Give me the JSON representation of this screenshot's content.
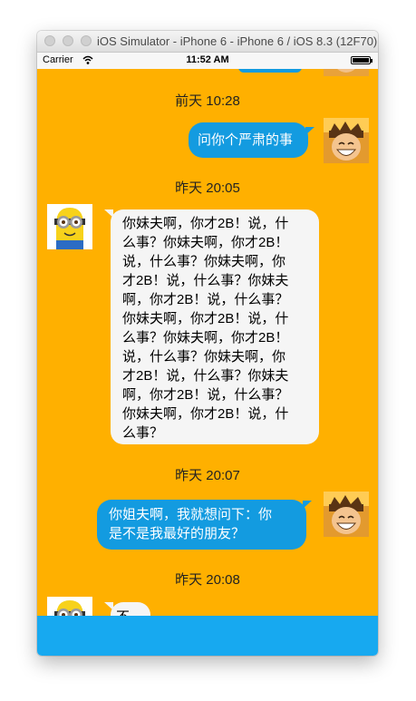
{
  "window": {
    "title": "iOS Simulator - iPhone 6 - iPhone 6 / iOS 8.3 (12F70)"
  },
  "status_bar": {
    "carrier": "Carrier",
    "time": "11:52 AM",
    "battery_level": 1.0
  },
  "colors": {
    "chat_background": "#ffb000",
    "outgoing_bubble": "#139be0",
    "incoming_bubble": "#f5f5f5",
    "input_bar": "#17a9f0"
  },
  "messages": [
    {
      "timestamp": "前天 10:28",
      "direction": "outgoing",
      "avatar": "luffy-avatar",
      "text": "问你个严肃的事"
    },
    {
      "timestamp": "昨天 20:05",
      "direction": "incoming",
      "avatar": "minion-avatar",
      "lines": [
        "你妹夫啊，你才2B！说，什",
        "么事？你妹夫啊，你才2B！",
        "说，什么事？你妹夫啊，你",
        "才2B！说，什么事？你妹夫",
        "啊，你才2B！说，什么事？",
        "你妹夫啊，你才2B！说，什",
        "么事？你妹夫啊，你才2B！",
        "说，什么事？你妹夫啊，你",
        "才2B！说，什么事？你妹夫",
        "啊，你才2B！说，什么事？",
        "你妹夫啊，你才2B！说，什",
        "么事？"
      ]
    },
    {
      "timestamp": "昨天 20:07",
      "direction": "outgoing",
      "avatar": "luffy-avatar",
      "lines": [
        "你姐夫啊，我就想问下：你",
        "是不是我最好的朋友？"
      ]
    },
    {
      "timestamp": "昨天 20:08",
      "direction": "incoming",
      "avatar": "minion-avatar",
      "text": "不帅"
    }
  ]
}
